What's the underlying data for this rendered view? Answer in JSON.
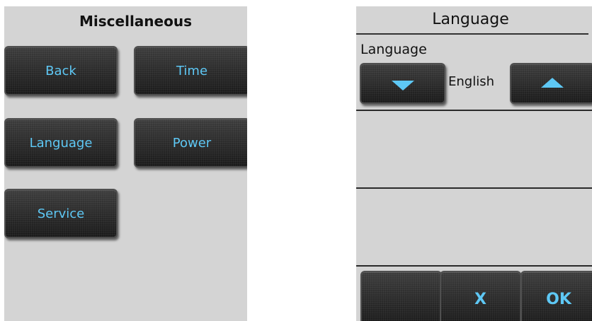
{
  "misc_screen": {
    "title": "Miscellaneous",
    "buttons": {
      "back": "Back",
      "time": "Time",
      "language": "Language",
      "power": "Power",
      "service": "Service"
    }
  },
  "language_screen": {
    "title": "Language",
    "field_label": "Language",
    "selected_value": "English",
    "buttons": {
      "decrement_icon": "down-arrow",
      "increment_icon": "up-arrow",
      "blank": "",
      "cancel": "X",
      "ok": "OK"
    }
  },
  "colors": {
    "screen_background": "#d4d4d4",
    "button_background": "#262626",
    "button_text": "#5ec8f5"
  }
}
